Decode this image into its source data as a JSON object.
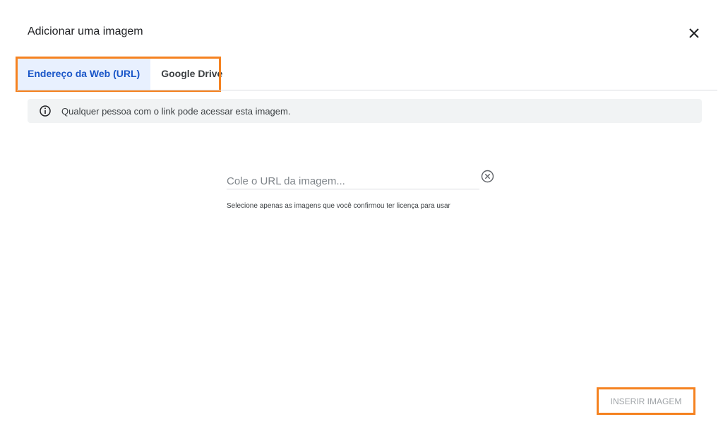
{
  "dialog": {
    "title": "Adicionar uma imagem",
    "close_icon": "close-icon"
  },
  "tabs": [
    {
      "label": "Endereço da Web (URL)",
      "active": true
    },
    {
      "label": "Google Drive",
      "active": false
    }
  ],
  "notice": {
    "icon": "info-icon",
    "text": "Qualquer pessoa com o link pode acessar esta imagem."
  },
  "url_field": {
    "placeholder": "Cole o URL da imagem...",
    "value": "",
    "clear_icon": "clear-circle-icon"
  },
  "license_hint": "Selecione apenas as imagens que você confirmou ter licença para usar",
  "insert_button": {
    "label": "INSERIR IMAGEM",
    "enabled": false
  },
  "colors": {
    "accent": "#1a56c8",
    "active_tab_bg": "#e8f0fe",
    "highlight_outline": "#f58220",
    "notice_bg": "#f1f3f4",
    "disabled_text": "#a0a4a8"
  }
}
